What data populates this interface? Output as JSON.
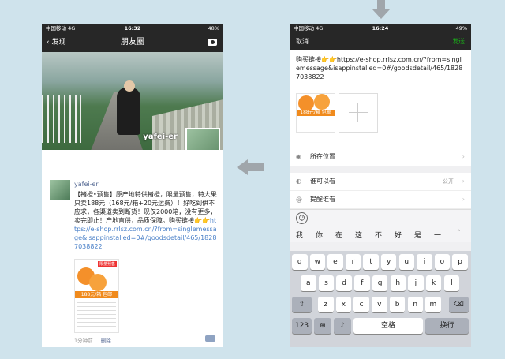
{
  "left_phone": {
    "status": {
      "signal": "中国移动 4G",
      "time": "16:32",
      "battery": "48%"
    },
    "nav": {
      "back": "发现",
      "title": "朋友圈"
    },
    "cover_username": "yafei-er",
    "post": {
      "user": "yafei-er",
      "text": "【褚橙•预售】原产地特供褚橙，限量预售，特大果只卖188元（168元/箱+20元运费）！好吃到供不应求，各渠道卖到断货！现仅2000箱，没有更多，卖完即止！产地直供，品质保障。购买链接👉👉",
      "link": "https://e-shop.rrlsz.com.cn/?from=singlemessage&isappinstalled=0#/goodsdetail/465/18287038822",
      "thumb_badge": "限量预售",
      "thumb_price": "188元/箱 包邮",
      "time_ago": "1分钟前",
      "delete": "删除"
    }
  },
  "right_phone": {
    "status": {
      "signal": "中国移动 4G",
      "time": "16:24",
      "battery": "49%"
    },
    "nav": {
      "cancel": "取消",
      "send": "发送"
    },
    "compose_text": "购买链接👉👉https://e-shop.rrlsz.com.cn/?from=singlemessage&isappinstalled=0#/goodsdetail/465/18287038822",
    "thumb_price": "188元/箱 包邮",
    "rows": [
      {
        "label": "所在位置",
        "value": ""
      },
      {
        "label": "谁可以看",
        "value": "公开"
      },
      {
        "label": "提醒谁看",
        "value": ""
      }
    ],
    "candidates": [
      "我",
      "你",
      "在",
      "这",
      "不",
      "好",
      "是",
      "一"
    ],
    "keys_row1": [
      "q",
      "w",
      "e",
      "r",
      "t",
      "y",
      "u",
      "i",
      "o",
      "p"
    ],
    "keys_row2": [
      "a",
      "s",
      "d",
      "f",
      "g",
      "h",
      "j",
      "k",
      "l"
    ],
    "keys_row3": [
      "z",
      "x",
      "c",
      "v",
      "b",
      "n",
      "m"
    ],
    "key_123": "123",
    "key_space": "空格",
    "key_return": "换行"
  }
}
